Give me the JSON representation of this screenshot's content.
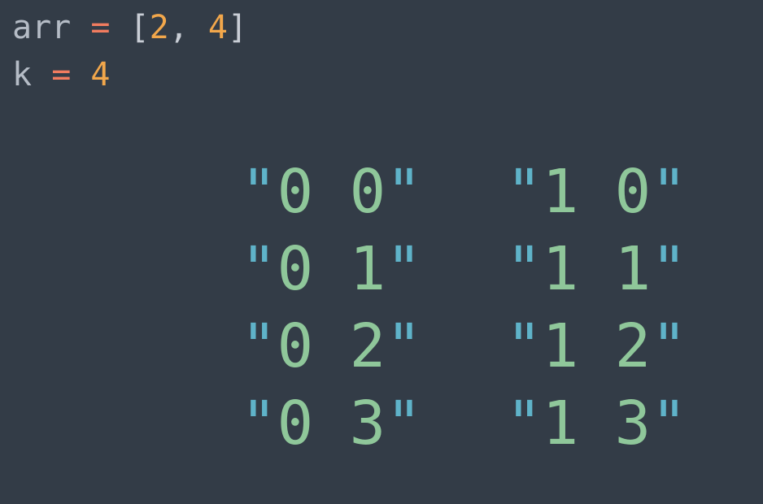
{
  "code": {
    "line1": {
      "ident": "arr",
      "op": "=",
      "open": "[",
      "v1": "2",
      "sep": ",",
      "v2": "4",
      "close": "]"
    },
    "line2": {
      "ident": "k",
      "op": "=",
      "value": "4"
    }
  },
  "strings": {
    "columns": [
      {
        "items": [
          "0 0",
          "0 1",
          "0 2",
          "0 3"
        ]
      },
      {
        "items": [
          "1 0",
          "1 1",
          "1 2",
          "1 3"
        ]
      }
    ],
    "quote_char": "\""
  },
  "colors": {
    "background": "#333c47",
    "identifier": "#b5bcc6",
    "operator": "#f27c5f",
    "number": "#f2a74b",
    "quote": "#5fb3c9",
    "string": "#8fc79a"
  }
}
